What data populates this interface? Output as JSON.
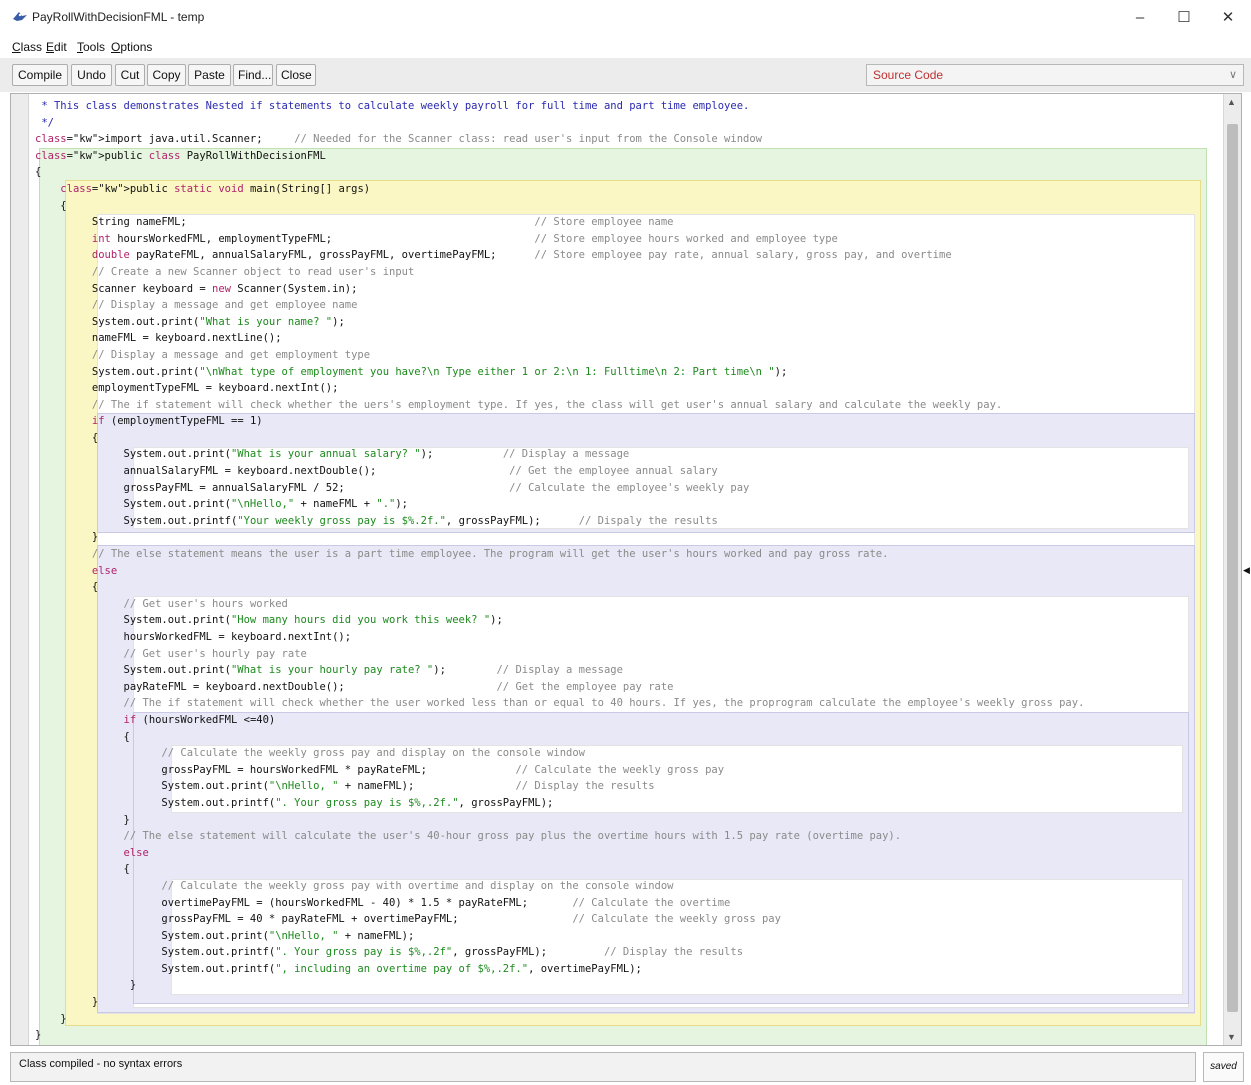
{
  "window": {
    "title": "PayRollWithDecisionFML - temp",
    "buttons": [
      "–",
      "☐",
      "✕"
    ]
  },
  "menu": [
    {
      "accel": "C",
      "rest": "lass"
    },
    {
      "accel": "E",
      "rest": "dit"
    },
    {
      "accel": "T",
      "rest": "ools"
    },
    {
      "accel": "O",
      "rest": "ptions"
    }
  ],
  "toolbar": {
    "compile": "Compile",
    "undo": "Undo",
    "cut": "Cut",
    "copy": "Copy",
    "paste": "Paste",
    "find": "Find...",
    "close": "Close",
    "view_selector": "Source Code"
  },
  "status": {
    "message": "Class compiled - no syntax errors",
    "saved": "saved"
  },
  "code_lines": [
    {
      "t": " * This class demonstrates Nested if statements to calculate weekly payroll for full time and part time employee.",
      "c": "cmb"
    },
    {
      "t": " */",
      "c": "cmb"
    },
    {
      "t": "import java.util.Scanner;     // Needed for the Scanner class: read user's input from the Console window",
      "c": ""
    },
    {
      "t": "public class PayRollWithDecisionFML",
      "c": ""
    },
    {
      "t": "{",
      "c": ""
    },
    {
      "t": "    public static void main(String[] args)",
      "c": ""
    },
    {
      "t": "    {",
      "c": ""
    },
    {
      "t": "         String nameFML;                                                       // Store employee name",
      "c": ""
    },
    {
      "t": "         int hoursWorkedFML, employmentTypeFML;                                // Store employee hours worked and employee type",
      "c": ""
    },
    {
      "t": "         double payRateFML, annualSalaryFML, grossPayFML, overtimePayFML;      // Store employee pay rate, annual salary, gross pay, and overtime",
      "c": ""
    },
    {
      "t": "         // Create a new Scanner object to read user's input",
      "c": ""
    },
    {
      "t": "         Scanner keyboard = new Scanner(System.in);",
      "c": ""
    },
    {
      "t": "         // Display a message and get employee name",
      "c": ""
    },
    {
      "t": "         System.out.print(\"What is your name? \");",
      "c": ""
    },
    {
      "t": "         nameFML = keyboard.nextLine();",
      "c": ""
    },
    {
      "t": "         // Display a message and get employment type",
      "c": ""
    },
    {
      "t": "         System.out.print(\"\\nWhat type of employment you have?\\n Type either 1 or 2:\\n 1: Fulltime\\n 2: Part time\\n \");",
      "c": ""
    },
    {
      "t": "         employmentTypeFML = keyboard.nextInt();",
      "c": ""
    },
    {
      "t": "         // The if statement will check whether the uers's employment type. If yes, the class will get user's annual salary and calculate the weekly pay.",
      "c": ""
    },
    {
      "t": "         if (employmentTypeFML == 1)",
      "c": ""
    },
    {
      "t": "         {",
      "c": ""
    },
    {
      "t": "              System.out.print(\"What is your annual salary? \");           // Display a message",
      "c": ""
    },
    {
      "t": "              annualSalaryFML = keyboard.nextDouble();                     // Get the employee annual salary",
      "c": ""
    },
    {
      "t": "              grossPayFML = annualSalaryFML / 52;                          // Calculate the employee's weekly pay",
      "c": ""
    },
    {
      "t": "              System.out.print(\"\\nHello,\" + nameFML + \".\");",
      "c": ""
    },
    {
      "t": "              System.out.printf(\"Your weekly gross pay is $%.2f.\", grossPayFML);      // Dispaly the results",
      "c": ""
    },
    {
      "t": "         }",
      "c": ""
    },
    {
      "t": "         // The else statement means the user is a part time employee. The program will get the user's hours worked and pay gross rate.",
      "c": ""
    },
    {
      "t": "         else",
      "c": ""
    },
    {
      "t": "         {",
      "c": ""
    },
    {
      "t": "              // Get user's hours worked",
      "c": ""
    },
    {
      "t": "              System.out.print(\"How many hours did you work this week? \");",
      "c": ""
    },
    {
      "t": "              hoursWorkedFML = keyboard.nextInt();",
      "c": ""
    },
    {
      "t": "              // Get user's hourly pay rate",
      "c": ""
    },
    {
      "t": "              System.out.print(\"What is your hourly pay rate? \");        // Display a message",
      "c": ""
    },
    {
      "t": "              payRateFML = keyboard.nextDouble();                        // Get the employee pay rate",
      "c": ""
    },
    {
      "t": "              // The if statement will check whether the user worked less than or equal to 40 hours. If yes, the proprogram calculate the employee's weekly gross pay.",
      "c": ""
    },
    {
      "t": "              if (hoursWorkedFML <=40)",
      "c": ""
    },
    {
      "t": "              {",
      "c": ""
    },
    {
      "t": "                    // Calculate the weekly gross pay and display on the console window",
      "c": ""
    },
    {
      "t": "                    grossPayFML = hoursWorkedFML * payRateFML;              // Calculate the weekly gross pay",
      "c": ""
    },
    {
      "t": "                    System.out.print(\"\\nHello, \" + nameFML);                // Display the results",
      "c": ""
    },
    {
      "t": "                    System.out.printf(\". Your gross pay is $%,.2f.\", grossPayFML);",
      "c": ""
    },
    {
      "t": "              }",
      "c": ""
    },
    {
      "t": "              // The else statement will calculate the user's 40-hour gross pay plus the overtime hours with 1.5 pay rate (overtime pay).",
      "c": ""
    },
    {
      "t": "              else",
      "c": ""
    },
    {
      "t": "              {",
      "c": ""
    },
    {
      "t": "                    // Calculate the weekly gross pay with overtime and display on the console window",
      "c": ""
    },
    {
      "t": "                    overtimePayFML = (hoursWorkedFML - 40) * 1.5 * payRateFML;       // Calculate the overtime",
      "c": ""
    },
    {
      "t": "                    grossPayFML = 40 * payRateFML + overtimePayFML;                  // Calculate the weekly gross pay",
      "c": ""
    },
    {
      "t": "                    System.out.print(\"\\nHello, \" + nameFML);",
      "c": ""
    },
    {
      "t": "                    System.out.printf(\". Your gross pay is $%,.2f\", grossPayFML);         // Display the results",
      "c": ""
    },
    {
      "t": "                    System.out.printf(\", including an overtime pay of $%,.2f.\", overtimePayFML);",
      "c": ""
    },
    {
      "t": "               }",
      "c": ""
    },
    {
      "t": "         }",
      "c": ""
    },
    {
      "t": "    }",
      "c": ""
    },
    {
      "t": "}",
      "c": ""
    }
  ]
}
